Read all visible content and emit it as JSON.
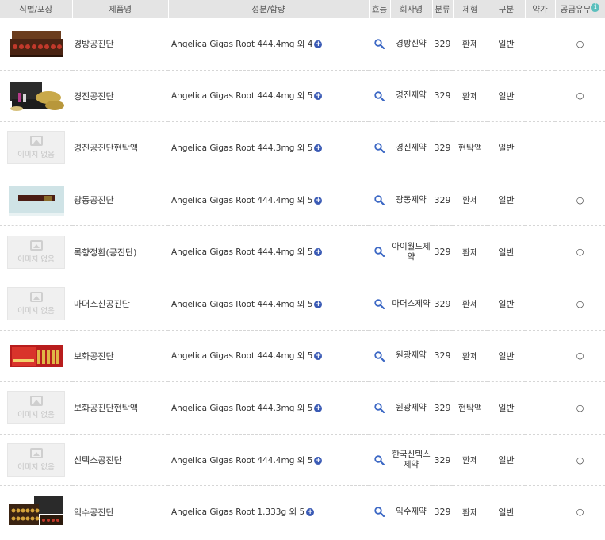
{
  "header": {
    "col_image": "식별/포장",
    "col_name": "제품명",
    "col_ingredient": "성분/함량",
    "col_effect": "효능",
    "col_company": "회사명",
    "col_class": "분류",
    "col_form": "제형",
    "col_type": "구분",
    "col_price": "약가",
    "col_supply": "공급유무",
    "info_icon": "i"
  },
  "no_image_text": "이미지 없음",
  "rows": [
    {
      "image": "box-red",
      "name": "경방공진단",
      "ingredient": "Angelica Gigas Root 444.4mg 외 4",
      "company": "경방신약",
      "class": "329",
      "form": "환제",
      "type": "일반",
      "price": "",
      "supply": "○"
    },
    {
      "image": "box-gold",
      "name": "경진공진단",
      "ingredient": "Angelica Gigas Root 444.4mg 외 5",
      "company": "경진제약",
      "class": "329",
      "form": "환제",
      "type": "일반",
      "price": "",
      "supply": "○"
    },
    {
      "image": "none",
      "name": "경진공진단현탁액",
      "ingredient": "Angelica Gigas Root 444.3mg 외 5",
      "company": "경진제약",
      "class": "329",
      "form": "현탁액",
      "type": "일반",
      "price": "",
      "supply": ""
    },
    {
      "image": "box-slim",
      "name": "광동공진단",
      "ingredient": "Angelica Gigas Root 444.4mg 외 5",
      "company": "광동제약",
      "class": "329",
      "form": "환제",
      "type": "일반",
      "price": "",
      "supply": "○"
    },
    {
      "image": "none",
      "name": "록향정환(공진단)",
      "ingredient": "Angelica Gigas Root 444.4mg 외 5",
      "company": "아이월드제약",
      "class": "329",
      "form": "환제",
      "type": "일반",
      "price": "",
      "supply": "○"
    },
    {
      "image": "none",
      "name": "마더스신공진단",
      "ingredient": "Angelica Gigas Root 444.4mg 외 5",
      "company": "마더스제약",
      "class": "329",
      "form": "환제",
      "type": "일반",
      "price": "",
      "supply": "○"
    },
    {
      "image": "box-redgold",
      "name": "보화공진단",
      "ingredient": "Angelica Gigas Root 444.4mg 외 5",
      "company": "원광제약",
      "class": "329",
      "form": "환제",
      "type": "일반",
      "price": "",
      "supply": "○"
    },
    {
      "image": "none",
      "name": "보화공진단현탁액",
      "ingredient": "Angelica Gigas Root 444.3mg 외 5",
      "company": "원광제약",
      "class": "329",
      "form": "현탁액",
      "type": "일반",
      "price": "",
      "supply": "○"
    },
    {
      "image": "none",
      "name": "신텍스공진단",
      "ingredient": "Angelica Gigas Root 444.4mg 외 5",
      "company": "한국신텍스제약",
      "class": "329",
      "form": "환제",
      "type": "일반",
      "price": "",
      "supply": "○"
    },
    {
      "image": "box-multi",
      "name": "익수공진단",
      "ingredient": "Angelica Gigas Root 1.333g 외 5",
      "company": "익수제약",
      "class": "329",
      "form": "환제",
      "type": "일반",
      "price": "",
      "supply": "○"
    }
  ]
}
